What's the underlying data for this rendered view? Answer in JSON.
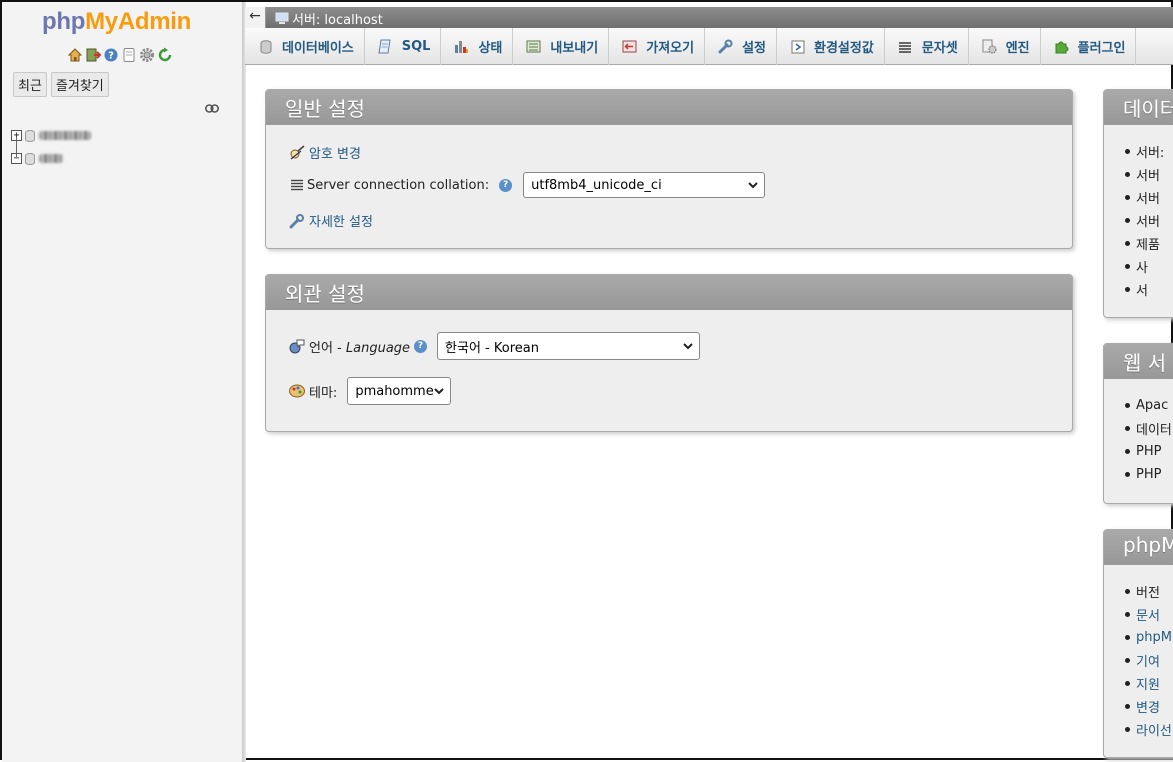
{
  "nav": {
    "logo": {
      "php": "php",
      "my": "My",
      "admin": "Admin"
    },
    "icons": [
      "home-icon",
      "exit-icon",
      "help-icon",
      "docs-icon",
      "gear-icon",
      "reload-icon"
    ],
    "tabs": [
      "최근",
      "즐겨찾기"
    ],
    "databases": [
      {
        "name": "(blurred)"
      },
      {
        "name": "(blurred)"
      }
    ]
  },
  "topbar": {
    "back": "←",
    "server_label": "서버: localhost"
  },
  "menu": [
    {
      "label": "데이터베이스",
      "icon": "database-icon"
    },
    {
      "label": "SQL",
      "icon": "sql-icon"
    },
    {
      "label": "상태",
      "icon": "status-icon"
    },
    {
      "label": "내보내기",
      "icon": "export-icon"
    },
    {
      "label": "가져오기",
      "icon": "import-icon"
    },
    {
      "label": "설정",
      "icon": "wrench-icon"
    },
    {
      "label": "환경설정값",
      "icon": "variables-icon"
    },
    {
      "label": "문자셋",
      "icon": "charset-icon"
    },
    {
      "label": "엔진",
      "icon": "engine-icon"
    },
    {
      "label": "플러그인",
      "icon": "plugin-icon"
    }
  ],
  "general": {
    "title": "일반 설정",
    "change_password": "암호 변경",
    "collation_label": "Server connection collation:",
    "collation_value": "utf8mb4_unicode_ci",
    "more_settings": "자세한 설정"
  },
  "appearance": {
    "title": "외관 설정",
    "language_label": "언어 - ",
    "language_label_italic": "Language",
    "language_value": "한국어 - Korean",
    "theme_label": "테마:",
    "theme_value": "pmahomme"
  },
  "right": {
    "db_server": {
      "title": "데이터",
      "items": [
        "서버:",
        "서버",
        "서버",
        "서버",
        "제품",
        "사",
        "서"
      ]
    },
    "web_server": {
      "title": "웹 서",
      "items": [
        "Apac",
        "데이터",
        "PHP",
        "PHP"
      ]
    },
    "pma": {
      "title": "phpM",
      "items": [
        "버전",
        "문서",
        "phpM",
        "기여",
        "지원",
        "변경",
        "라이선"
      ]
    }
  },
  "colors": {
    "link": "#235a81",
    "logo_php": "#6c78af",
    "logo_myadmin": "#f89c0e",
    "panel_head": "#a3a3a3"
  }
}
